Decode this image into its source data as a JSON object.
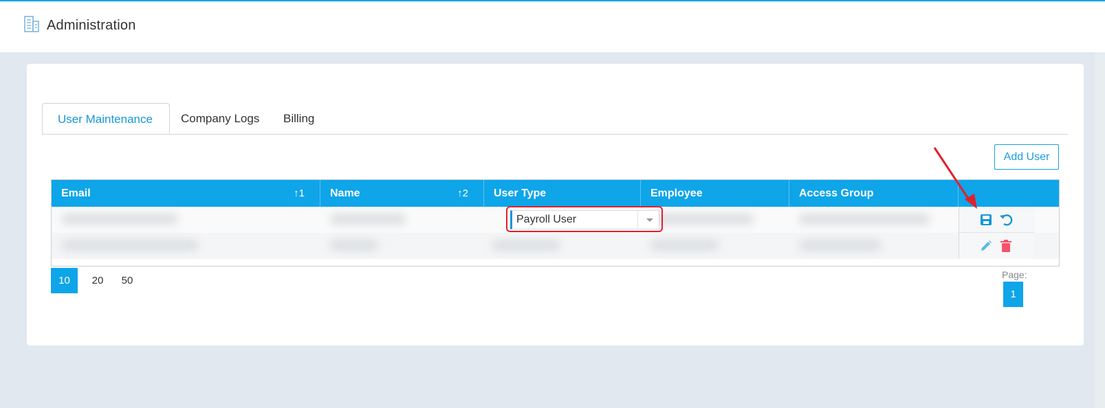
{
  "app": {
    "title": "Administration",
    "logo_icon": "building-icon"
  },
  "tabs": [
    {
      "label": "User Maintenance",
      "active": true
    },
    {
      "label": "Company Logs",
      "active": false
    },
    {
      "label": "Billing",
      "active": false
    }
  ],
  "toolbar": {
    "add_user_label": "Add User"
  },
  "table": {
    "columns": [
      {
        "label": "Email",
        "sort": "↑1"
      },
      {
        "label": "Name",
        "sort": "↑2"
      },
      {
        "label": "User Type",
        "sort": ""
      },
      {
        "label": "Employee",
        "sort": ""
      },
      {
        "label": "Access Group",
        "sort": ""
      }
    ],
    "editing_row": {
      "user_type_value": "Payroll User",
      "actions": [
        "save-icon",
        "undo-icon"
      ]
    },
    "row2_actions": [
      "edit-icon",
      "delete-icon"
    ]
  },
  "pager": {
    "page_sizes": [
      "10",
      "20",
      "50"
    ],
    "selected_size": "10",
    "page_label": "Page:",
    "current_page": "1"
  },
  "colors": {
    "accent": "#0ea5e9",
    "link": "#1696d8",
    "delete": "#f5536c",
    "highlight": "#e0202c"
  }
}
